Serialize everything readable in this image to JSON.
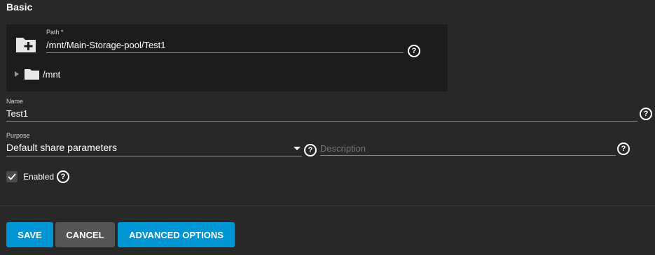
{
  "section": {
    "title": "Basic"
  },
  "path": {
    "label": "Path *",
    "value": "/mnt/Main-Storage-pool/Test1",
    "tree_root": "/mnt"
  },
  "name": {
    "label": "Name",
    "value": "Test1"
  },
  "purpose": {
    "label": "Purpose",
    "value": "Default share parameters"
  },
  "description": {
    "placeholder": "Description",
    "value": ""
  },
  "enabled": {
    "label": "Enabled",
    "checked": true
  },
  "help_glyph": "?",
  "buttons": {
    "save": "SAVE",
    "cancel": "CANCEL",
    "advanced": "ADVANCED OPTIONS"
  },
  "colors": {
    "background": "#282828",
    "panel": "#1c1c1c",
    "primary": "#0095d5",
    "secondary": "#555555"
  }
}
